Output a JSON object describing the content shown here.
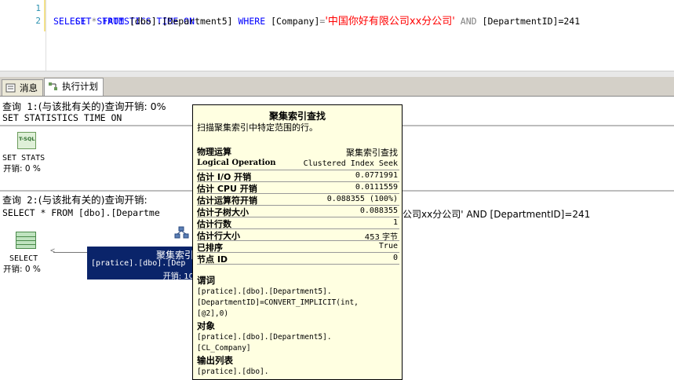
{
  "editor": {
    "line_numbers": [
      "1",
      "2"
    ],
    "line1": {
      "kw1": "SET STATISTICS TIME ON"
    },
    "line2": {
      "select": "SELECT",
      "star": "*",
      "from": "FROM",
      "table": "[dbo].[Department5]",
      "where": "WHERE",
      "col": "[Company]",
      "eq": "=",
      "str": "'中国你好有限公司xx分公司'",
      "and": "AND",
      "tail": "[DepartmentID]=241"
    }
  },
  "tabs": [
    {
      "label": "消息",
      "icon": "messages-icon"
    },
    {
      "label": "执行计划",
      "icon": "execution-plan-icon"
    }
  ],
  "query1": {
    "header_prefix": "查询 1:",
    "header_text": "(与该批有关的)查询开销: 0%",
    "sql": "SET STATISTICS TIME ON",
    "node_label": "SET STATS",
    "node_icon_text": "T-SQL",
    "node_cost": "开销: 0 %"
  },
  "query2": {
    "header_prefix": "查询 2:",
    "header_text": "(与该批有关的)查询开销:",
    "sql_left": "SELECT * FROM [dbo].[Departme",
    "sql_right": "公司xx分公司' AND [DepartmentID]=241",
    "select_label": "SELECT",
    "select_cost": "开销: 0 %",
    "seek_label": "聚集索引",
    "seek_object": "[pratice].[dbo].[Dep",
    "seek_cost": "开销: 10"
  },
  "tooltip": {
    "title": "聚集索引查找",
    "description": "扫描聚集索引中特定范围的行。",
    "physical_op_label": "物理运算",
    "physical_op_value": "聚集索引查找",
    "rows": [
      {
        "k": "Logical Operation",
        "v": "Clustered Index Seek"
      },
      {
        "k": "估计 I/O 开销",
        "v": "0.0771991"
      },
      {
        "k": "估计 CPU 开销",
        "v": "0.0111559"
      },
      {
        "k": "估计运算符开销",
        "v": "0.088355 (100%)"
      },
      {
        "k": "估计子树大小",
        "v": "0.088355"
      },
      {
        "k": "估计行数",
        "v": "1"
      },
      {
        "k": "估计行大小",
        "v": "453 字节"
      },
      {
        "k": "已排序",
        "v": "True"
      },
      {
        "k": "节点 ID",
        "v": "0"
      }
    ],
    "predicate_label": "谓词",
    "predicate_text": "[pratice].[dbo].[Department5].\n[DepartmentID]=CONVERT_IMPLICIT(int,\n[@2],0)",
    "object_label": "对象",
    "object_text": "[pratice].[dbo].[Department5].\n[CL_Company]",
    "output_label": "输出列表",
    "output_text": "[pratice].[dbo]."
  }
}
